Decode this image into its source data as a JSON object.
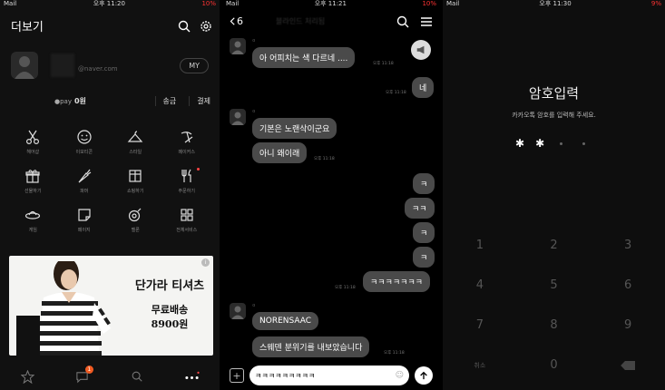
{
  "status": {
    "p1": {
      "carrier": "Mail",
      "time": "오후 11:20",
      "battery": "10%"
    },
    "p2": {
      "carrier": "Mail",
      "time": "오후 11:21",
      "battery": "10%"
    },
    "p3": {
      "carrier": "Mail",
      "time": "오후 11:30",
      "battery": "9%"
    }
  },
  "more": {
    "title": "더보기",
    "email": "@naver.com",
    "my_button": "MY",
    "pay_logo": "●pay",
    "pay_amount": "0원",
    "send_label": "송금",
    "pay_label": "결제",
    "grid": [
      {
        "label": "헤어샵",
        "icon": "scissors-icon"
      },
      {
        "label": "이모티콘",
        "icon": "emoticon-icon"
      },
      {
        "label": "스타일",
        "icon": "hanger-icon"
      },
      {
        "label": "메이커스",
        "icon": "makers-icon"
      },
      {
        "label": "선물하기",
        "icon": "gift-icon"
      },
      {
        "label": "파머",
        "icon": "carrot-icon"
      },
      {
        "label": "쇼핑하기",
        "icon": "shop-icon"
      },
      {
        "label": "주문하기",
        "icon": "fork-knife-icon"
      },
      {
        "label": "게임",
        "icon": "ufo-icon"
      },
      {
        "label": "페이지",
        "icon": "page-icon"
      },
      {
        "label": "멜론",
        "icon": "melon-icon"
      },
      {
        "label": "전체서비스",
        "icon": "grid-icon"
      }
    ],
    "ad": {
      "line1": "단가라 티셔츠",
      "line2": "무료배송",
      "line3": "8900원",
      "info": "i"
    },
    "tab_badge": "1"
  },
  "chat": {
    "back_count": "6",
    "title": "블라인드 처리됨",
    "messages": [
      {
        "side": "left",
        "sender": "ㅁ",
        "text": "아 어피치는 색 다르네 ....",
        "time": "오후 11:18"
      },
      {
        "side": "right",
        "text": "네",
        "time": "오후 11:18"
      },
      {
        "side": "left",
        "sender": "ㅁ",
        "text": "기본은 노랜삭이군요",
        "time": ""
      },
      {
        "side": "left",
        "text": "아니 왜이래",
        "time": "오후 11:18"
      },
      {
        "side": "right",
        "text": "ㅋ",
        "time": ""
      },
      {
        "side": "right",
        "text": "ㅋㅋ",
        "time": ""
      },
      {
        "side": "right",
        "text": "ㅋ",
        "time": ""
      },
      {
        "side": "right",
        "text": "ㅋ",
        "time": ""
      },
      {
        "side": "right",
        "text": "ㅋㅋㅋㅋㅋㅋㅋ",
        "time": "오후 11:18"
      },
      {
        "side": "left",
        "sender": "ㅁ",
        "text": "NORENSAAC",
        "time": ""
      },
      {
        "side": "left",
        "text": "스웨덴 분위기를 내보았습니다",
        "time": "오후 11:18"
      }
    ],
    "input_value": "ㅋㅋㅋㅋㅋㅋㅋㅋㅋ"
  },
  "passcode": {
    "title": "암호입력",
    "subtitle": "카카오톡 암호를 입력해 주세요.",
    "entered": 2,
    "length": 4,
    "keys": [
      "1",
      "2",
      "3",
      "4",
      "5",
      "6",
      "7",
      "8",
      "9",
      "취소",
      "0",
      "delete"
    ]
  }
}
